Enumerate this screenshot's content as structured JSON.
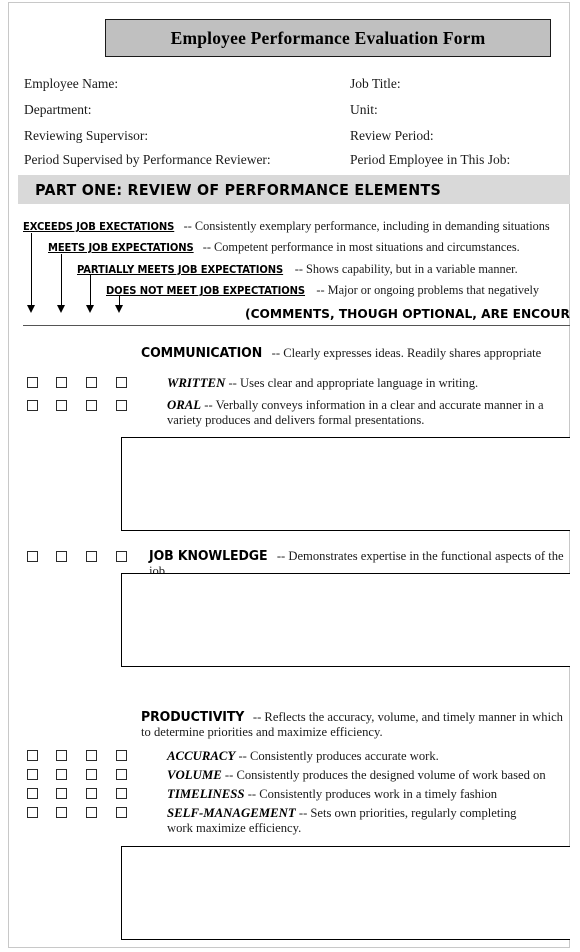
{
  "document": {
    "title": "Employee Performance Evaluation Form"
  },
  "header_fields": {
    "left": [
      {
        "label": "Employee Name:"
      },
      {
        "label": "Department:"
      },
      {
        "label": "Reviewing Supervisor:"
      },
      {
        "label": "Period Supervised by Performance Reviewer:"
      }
    ],
    "right": [
      {
        "label": "Job Title:"
      },
      {
        "label": "Unit:"
      },
      {
        "label": "Review Period:"
      },
      {
        "label": "Period Employee in This Job:"
      }
    ]
  },
  "part_one": {
    "banner": "PART ONE: REVIEW OF PERFORMANCE ELEMENTS",
    "rating_scale": [
      {
        "label": "EXCEEDS JOB EXECTATIONS",
        "description": "-- Consistently exemplary performance, including in demanding situations"
      },
      {
        "label": "MEETS JOB EXPECTATIONS",
        "description": "-- Competent performance in most situations and circumstances."
      },
      {
        "label": "PARTIALLY MEETS JOB EXPECTATIONS",
        "description": "-- Shows capability, but in a variable manner."
      },
      {
        "label": "DOES NOT MEET JOB EXPECTATIONS",
        "description": "-- Major or ongoing problems that negatively"
      }
    ],
    "comments_note": "(COMMENTS, THOUGH OPTIONAL, ARE ENCOURAGED)"
  },
  "sections": [
    {
      "name": "COMMUNICATION",
      "description": "-- Clearly expresses ideas.  Readily shares appropriate",
      "items": [
        {
          "name": "WRITTEN",
          "description": "-- Uses clear and appropriate language in writing."
        },
        {
          "name": "ORAL",
          "description": "-- Verbally conveys information in a clear and accurate manner in a variety produces and delivers formal presentations."
        }
      ]
    },
    {
      "name": "JOB KNOWLEDGE",
      "description": "-- Demonstrates expertise in the functional aspects of the job.",
      "items": []
    },
    {
      "name": "PRODUCTIVITY",
      "description": "-- Reflects the accuracy, volume, and timely manner in which to determine priorities and maximize efficiency.",
      "items": [
        {
          "name": "ACCURACY",
          "description": "-- Consistently produces accurate work."
        },
        {
          "name": "VOLUME",
          "description": "-- Consistently produces the designed volume of work based on"
        },
        {
          "name": "TIMELINESS",
          "description": "-- Consistently produces work in a timely fashion"
        },
        {
          "name": "SELF-MANAGEMENT",
          "description": "-- Sets own priorities, regularly completing work maximize efficiency."
        }
      ]
    }
  ],
  "colors": {
    "title_bar_fill": "#c0c0c0",
    "banner_fill": "#d9d9d9",
    "ink": "#000000"
  }
}
